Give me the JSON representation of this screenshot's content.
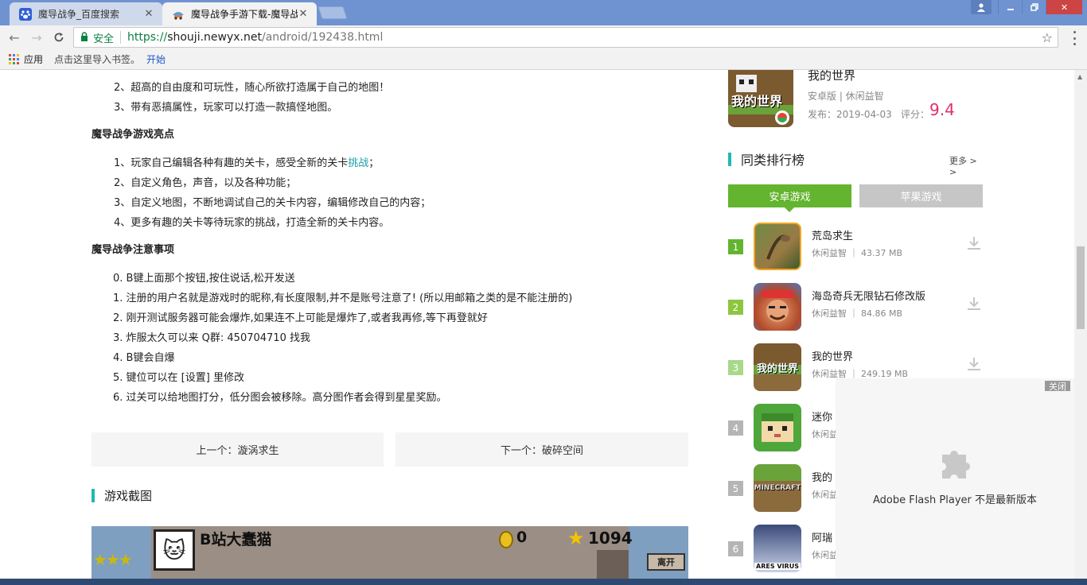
{
  "browser": {
    "tabs": [
      {
        "title": "魔导战争_百度搜索",
        "favicon": "baidu-paw-icon"
      },
      {
        "title": "魔导战争手游下载-魔导战",
        "favicon": "newyx-favicon",
        "active": true
      }
    ],
    "address": {
      "secure_label": "安全",
      "scheme": "https://",
      "host": "shouji.newyx.net",
      "path": "/android/192438.html"
    },
    "bookmarks": {
      "apps": "应用",
      "hint": "点击这里导入书签。",
      "start": "开始"
    }
  },
  "content": {
    "intro_items": [
      "2、超高的自由度和可玩性，随心所欲打造属于自己的地图！",
      "3、带有恶搞属性，玩家可以打造一款搞怪地图。"
    ],
    "highlights_title": "魔导战争游戏亮点",
    "highlight_1_pre": "1、玩家自己编辑各种有趣的关卡，感受全新的关卡",
    "highlight_1_link": "挑战",
    "highlight_1_post": "；",
    "highlight_items": [
      "2、自定义角色，声音，以及各种功能；",
      "3、自定义地图，不断地调试自己的关卡内容，编辑修改自己的内容；",
      "4、更多有趣的关卡等待玩家的挑战，打造全新的关卡内容。"
    ],
    "notes_title": "魔导战争注意事项",
    "notes": [
      "0. B键上面那个按钮,按住说话,松开发送",
      "1. 注册的用户名就是游戏时的昵称,有长度限制,并不是账号注意了! (所以用邮箱之类的是不能注册的)",
      "2. 刚开测试服务器可能会爆炸,如果连不上可能是爆炸了,或者我再修,等下再登就好",
      "3. 炸服太久可以来 Q群: 450704710 找我",
      "4. B键会自爆",
      "5. 键位可以在 [设置] 里修改",
      "6. 过关可以给地图打分，低分图会被移除。高分图作者会得到星星奖励。"
    ],
    "prev": "上一个：漩涡求生",
    "next": "下一个：破碎空间",
    "screenshots_title": "游戏截图",
    "screenshot": {
      "player_name": "B站大蠢猫",
      "coins": "0",
      "stars": "1094",
      "leave_button": "离开"
    }
  },
  "sidebar": {
    "featured": {
      "title": "我的世界",
      "meta": "安卓版 | 休闲益智",
      "date": "发布：2019-04-03",
      "score_label": "评分：",
      "score": "9.4"
    },
    "ranking_title": "同类排行榜",
    "more": "更多 > >",
    "tab_android": "安卓游戏",
    "tab_apple": "苹果游戏",
    "items": [
      {
        "rank": "1",
        "name": "荒岛求生",
        "meta": "休闲益智 ｜ 43.37 MB",
        "color": "#63b42e"
      },
      {
        "rank": "2",
        "name": "海岛奇兵无限钻石修改版",
        "meta": "休闲益智 ｜ 84.86 MB",
        "color": "#8cc63f"
      },
      {
        "rank": "3",
        "name": "我的世界",
        "meta": "休闲益智 ｜ 249.19 MB",
        "color": "#a8d88a"
      },
      {
        "rank": "4",
        "name": "迷你",
        "meta": "休闲益",
        "color": "#b5b5b5"
      },
      {
        "rank": "5",
        "name": "我的",
        "meta": "休闲益",
        "color": "#b5b5b5"
      },
      {
        "rank": "6",
        "name": "阿瑞",
        "meta": "休闲益",
        "color": "#b5b5b5"
      }
    ],
    "icon_texts": {
      "minecraft_cn": "我的世界",
      "minecraft_en": "MINECRAFT",
      "ares": "ARES VIRUS"
    }
  },
  "flash": {
    "close": "关闭",
    "message": "Adobe Flash Player 不是最新版本"
  }
}
